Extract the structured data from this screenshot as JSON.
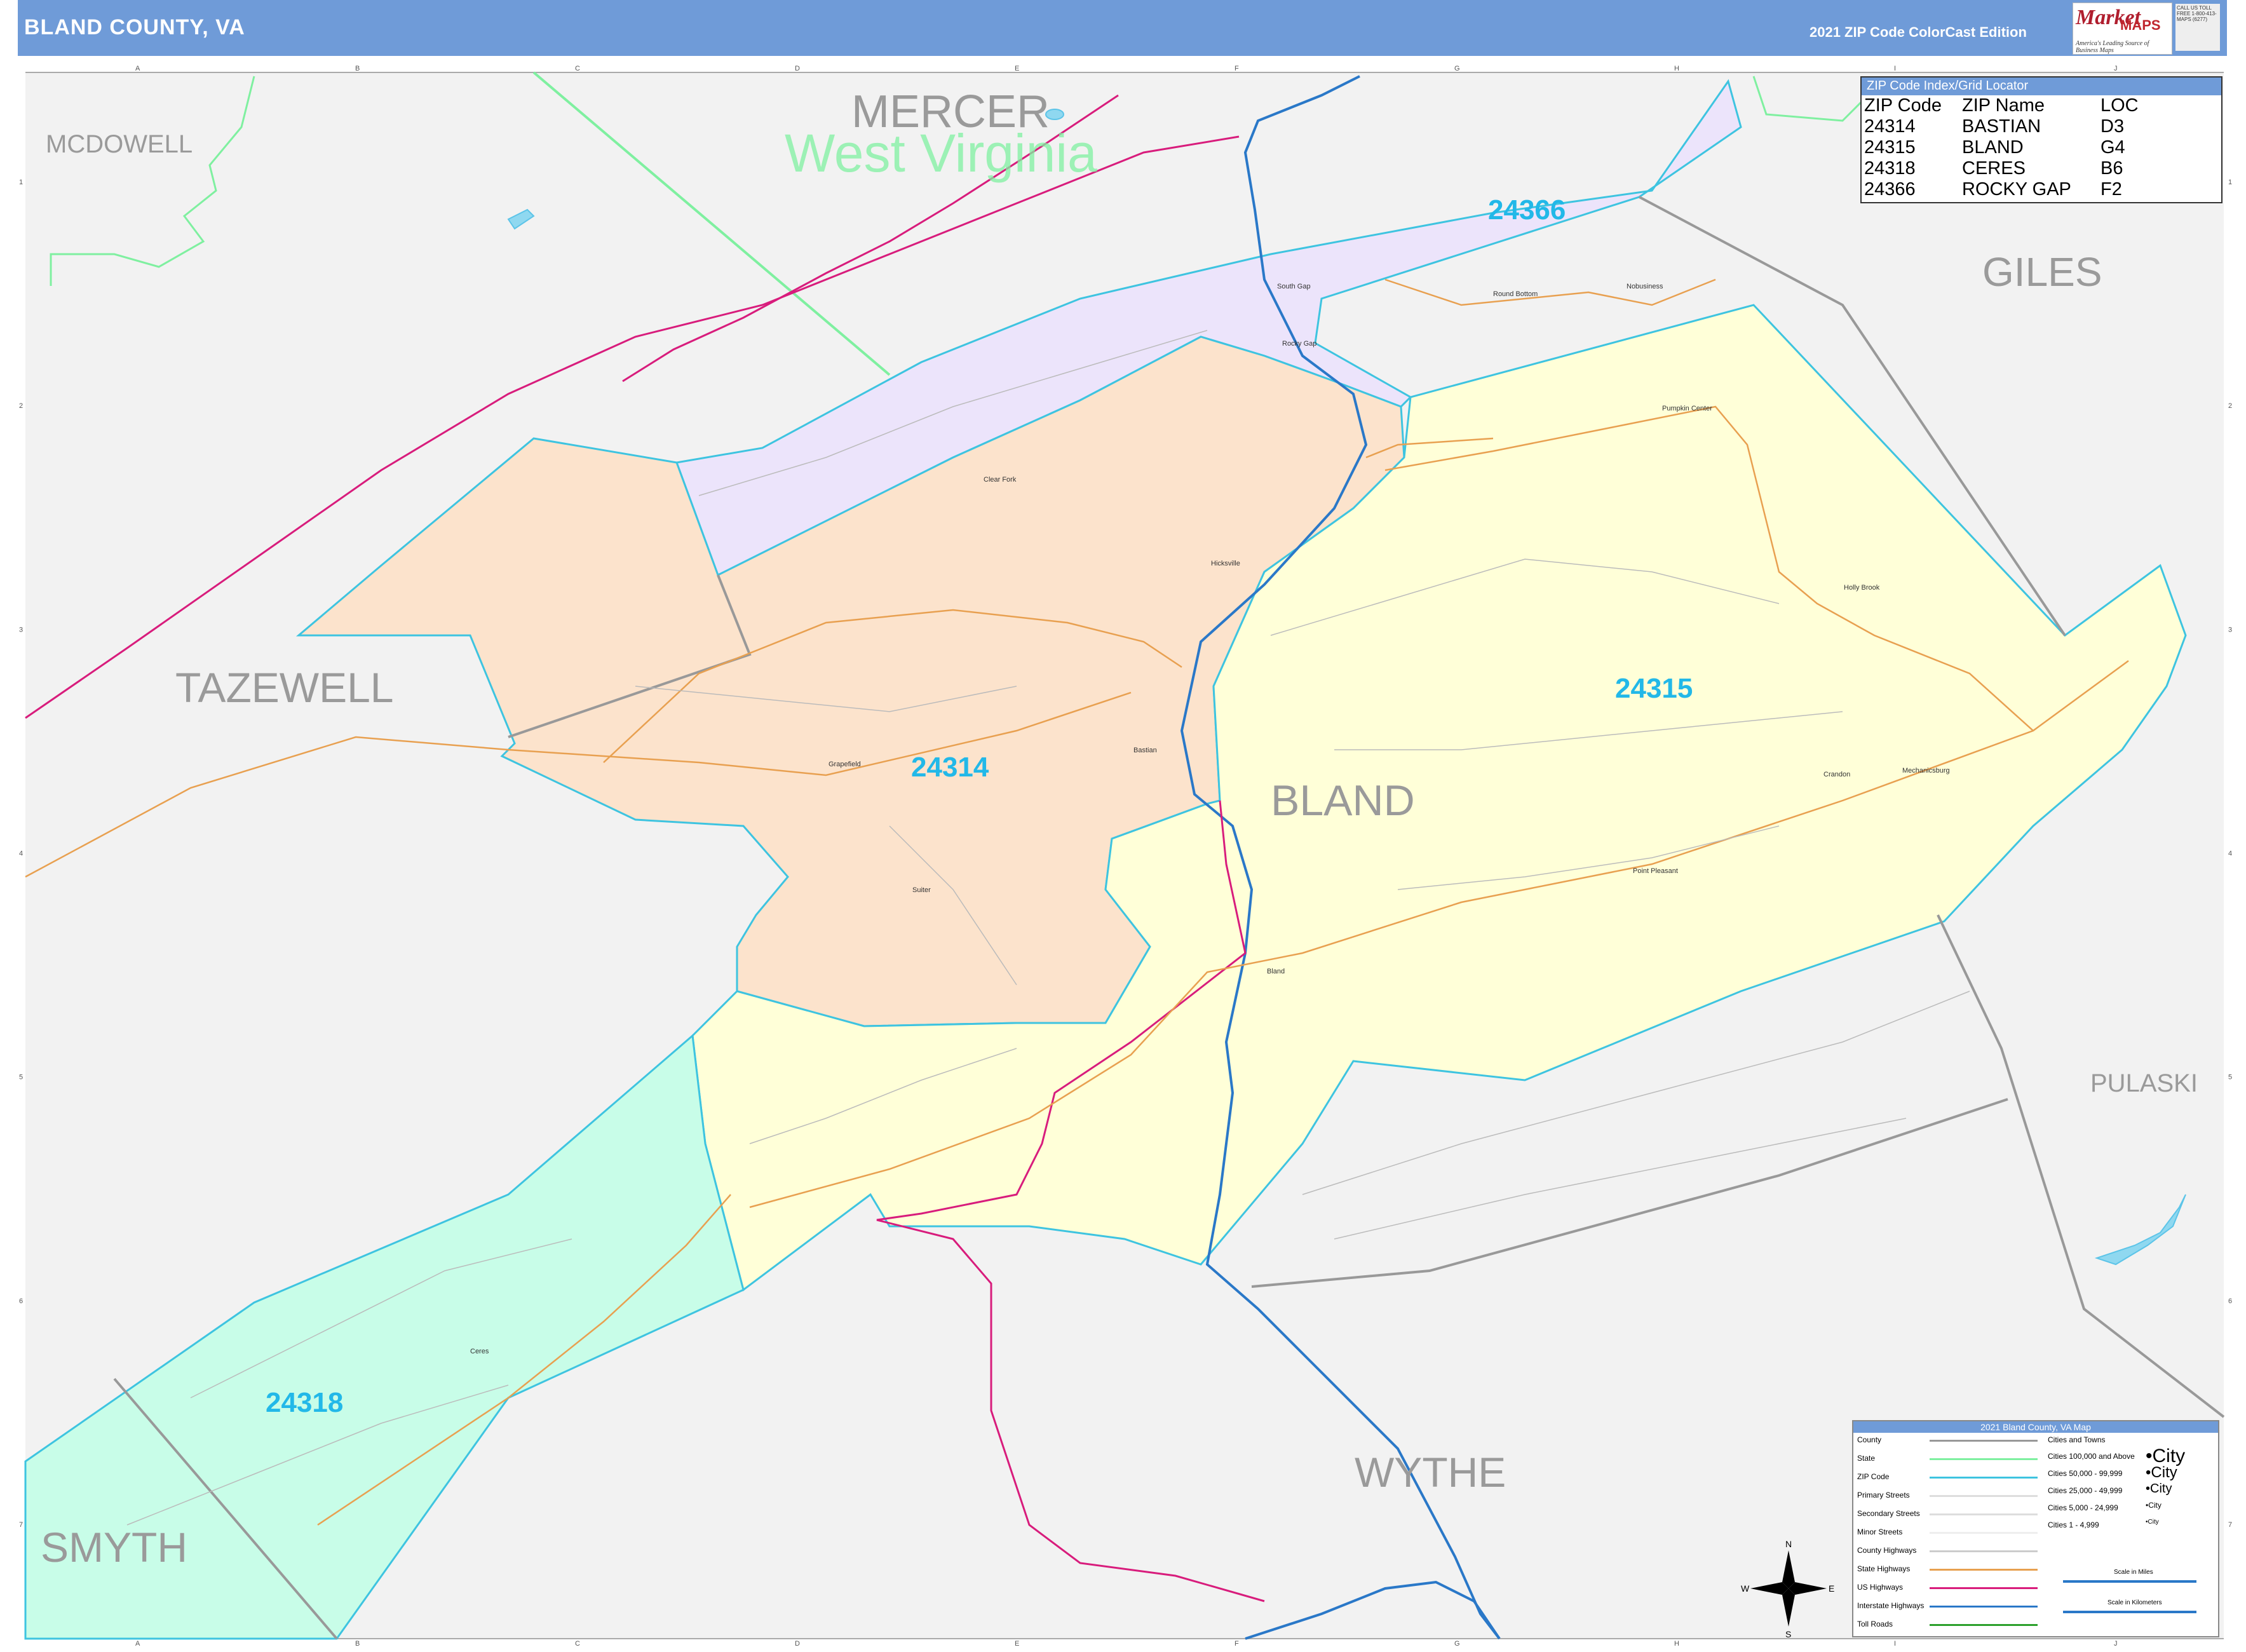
{
  "header": {
    "title": "BLAND COUNTY, VA",
    "edition": "2021 ZIP Code ColorCast Edition"
  },
  "logo": {
    "brand_m": "Market",
    "brand_maps": "MAPS",
    "tagline": "America's Leading Source of Business Maps",
    "contact": "CALL US TOLL FREE 1-800-413-MAPS (6277)"
  },
  "grid": {
    "columns": [
      "A",
      "B",
      "C",
      "D",
      "E",
      "F",
      "G",
      "H",
      "I",
      "J"
    ],
    "rows": [
      "1",
      "2",
      "3",
      "4",
      "5",
      "6",
      "7"
    ]
  },
  "zip_index": {
    "title": "ZIP Code Index/Grid Locator",
    "headers": [
      "ZIP Code",
      "ZIP Name",
      "LOC"
    ],
    "rows": [
      [
        "24314",
        "BASTIAN",
        "D3"
      ],
      [
        "24315",
        "BLAND",
        "G4"
      ],
      [
        "24318",
        "CERES",
        "B6"
      ],
      [
        "24366",
        "ROCKY GAP",
        "F2"
      ]
    ]
  },
  "county_labels": {
    "mercer": "MERCER",
    "mcdowell": "MCDOWELL",
    "giles": "GILES",
    "tazewell": "TAZEWELL",
    "bland": "BLAND",
    "pulaski": "PULASKI",
    "wythe": "WYTHE",
    "smyth": "SMYTH"
  },
  "state_label": "West Virginia",
  "zip_labels": {
    "z24366": "24366",
    "z24314": "24314",
    "z24315": "24315",
    "z24318": "24318"
  },
  "place_labels": {
    "south_gap": "South Gap",
    "rocky_gap": "Rocky Gap",
    "round_bottom": "Round Bottom",
    "nobusiness": "Nobusiness",
    "pumpkin_center": "Pumpkin Center",
    "clear_fork": "Clear Fork",
    "hicksville": "Hicksville",
    "holly_brook": "Holly Brook",
    "grapefield": "Grapefield",
    "bastian": "Bastian",
    "crandon": "Crandon",
    "mechanicsburg": "Mechanicsburg",
    "point_pleasant": "Point Pleasant",
    "suiter": "Suiter",
    "bland": "Bland",
    "ceres": "Ceres"
  },
  "legend": {
    "title": "2021 Bland County, VA Map",
    "items": [
      "County",
      "State",
      "ZIP Code",
      "Primary Streets",
      "Secondary Streets",
      "Minor Streets",
      "County Highways",
      "State Highways",
      "US Highways",
      "Interstate Highways",
      "Toll Roads"
    ],
    "cities_title": "Cities and Towns",
    "cities": [
      "Cities 100,000 and Above",
      "Cities 50,000 - 99,999",
      "Cities 25,000 - 49,999",
      "Cities 5,000 - 24,999",
      "Cities 1 - 4,999"
    ],
    "city_samples": [
      "City",
      "City",
      "City",
      "City",
      "City"
    ],
    "scale_miles": "Scale in Miles",
    "scale_km": "Scale in Kilometers"
  },
  "compass": {
    "n": "N",
    "s": "S",
    "e": "E",
    "w": "W"
  },
  "colors": {
    "header": "#6f9bd8",
    "z24366": "#ece4fb",
    "z24314": "#fce3cc",
    "z24315": "#ffffd8",
    "z24318": "#c8fde8",
    "zip_border": "#3ec4e0",
    "interstate": "#2a78c8",
    "us_highway": "#d81c7c",
    "state_highway": "#e8a050",
    "state_border": "#7ff0a0",
    "county_border": "#999999",
    "outside": "#f2f2f2"
  }
}
